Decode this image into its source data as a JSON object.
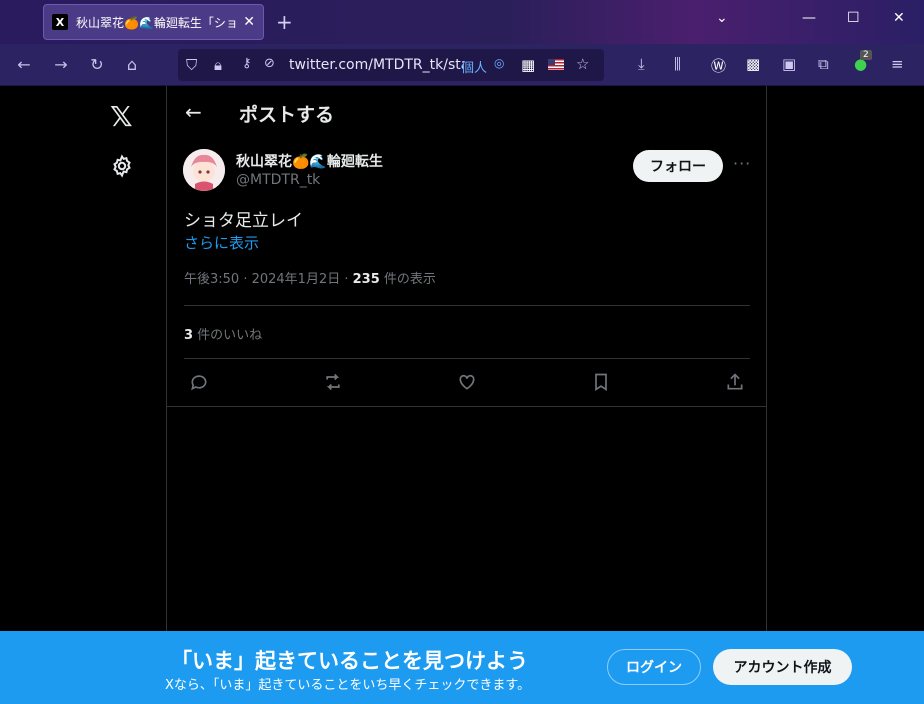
{
  "browser": {
    "tab_title": "秋山翠花🍊🌊輪廻転生「ショ",
    "tab_favicon": "X",
    "url": "twitter.com/MTDTR_tk/stat",
    "url_extra": "個人",
    "extension_badge": "2",
    "icons": [
      "back-icon",
      "forward-icon",
      "reload-icon",
      "home-icon",
      "shield-icon",
      "lock-icon",
      "permissions-icon",
      "tracking-off-icon",
      "qr-icon",
      "flag-us-icon",
      "star-icon",
      "download-icon",
      "library-icon",
      "extension-w-icon",
      "extension-qr-icon",
      "extension-square-icon",
      "puzzle-icon",
      "extension-green-icon",
      "menu-icon"
    ]
  },
  "sidebar": {
    "logo": "𝕏"
  },
  "header": {
    "back": "←",
    "title": "ポストする"
  },
  "tweet": {
    "author_name": "秋山翠花🍊🌊輪廻転生",
    "handle": "@MTDTR_tk",
    "follow_label": "フォロー",
    "more": "···",
    "text": "ショタ足立レイ",
    "show_more": "さらに表示",
    "time": "午後3:50 · 2024年1月2日 · ",
    "views_count": "235",
    "views_label": " 件の表示",
    "likes_count": "3",
    "likes_label": " 件のいいね"
  },
  "banner": {
    "title": "「いま」起きていることを見つけよう",
    "subtitle": "Xなら、「いま」起きていることをいち早くチェックできます。",
    "login_label": "ログイン",
    "signup_label": "アカウント作成"
  },
  "colors": {
    "accent": "#1d9bf0",
    "background": "#000000",
    "text": "#e7e9ea",
    "muted": "#71767b"
  }
}
